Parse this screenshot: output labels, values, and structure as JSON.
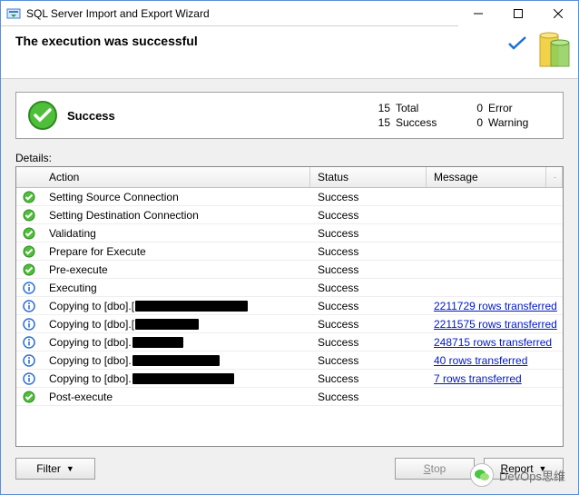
{
  "window": {
    "title": "SQL Server Import and Export Wizard"
  },
  "header": {
    "title": "The execution was successful"
  },
  "summary": {
    "label": "Success",
    "total_n": "15",
    "total_label": "Total",
    "success_n": "15",
    "success_label": "Success",
    "error_n": "0",
    "error_label": "Error",
    "warning_n": "0",
    "warning_label": "Warning"
  },
  "details_label": "Details:",
  "columns": {
    "action": "Action",
    "status": "Status",
    "message": "Message"
  },
  "rows": [
    {
      "icon": "ok",
      "action": "Setting Source Connection",
      "status": "Success",
      "message": "",
      "link": false,
      "redact_w": 0
    },
    {
      "icon": "ok",
      "action": "Setting Destination Connection",
      "status": "Success",
      "message": "",
      "link": false,
      "redact_w": 0
    },
    {
      "icon": "ok",
      "action": "Validating",
      "status": "Success",
      "message": "",
      "link": false,
      "redact_w": 0
    },
    {
      "icon": "ok",
      "action": "Prepare for Execute",
      "status": "Success",
      "message": "",
      "link": false,
      "redact_w": 0
    },
    {
      "icon": "ok",
      "action": "Pre-execute",
      "status": "Success",
      "message": "",
      "link": false,
      "redact_w": 0
    },
    {
      "icon": "info",
      "action": "Executing",
      "status": "Success",
      "message": "",
      "link": false,
      "redact_w": 0
    },
    {
      "icon": "info",
      "action": "Copying to [dbo].[",
      "status": "Success",
      "message": "2211729 rows transferred",
      "link": true,
      "redact_w": 124
    },
    {
      "icon": "info",
      "action": "Copying to [dbo].[",
      "status": "Success",
      "message": "2211575 rows transferred",
      "link": true,
      "redact_w": 70
    },
    {
      "icon": "info",
      "action": "Copying to [dbo].",
      "status": "Success",
      "message": "248715 rows transferred",
      "link": true,
      "redact_w": 56
    },
    {
      "icon": "info",
      "action": "Copying to [dbo].",
      "status": "Success",
      "message": "40 rows transferred",
      "link": true,
      "redact_w": 96
    },
    {
      "icon": "info",
      "action": "Copying to [dbo].",
      "status": "Success",
      "message": "7 rows transferred",
      "link": true,
      "redact_w": 112
    },
    {
      "icon": "ok",
      "action": "Post-execute",
      "status": "Success",
      "message": "",
      "link": false,
      "redact_w": 0
    }
  ],
  "buttons": {
    "filter": "Filter",
    "stop": "Stop",
    "report": "Report"
  },
  "watermark": "DevOps思维"
}
